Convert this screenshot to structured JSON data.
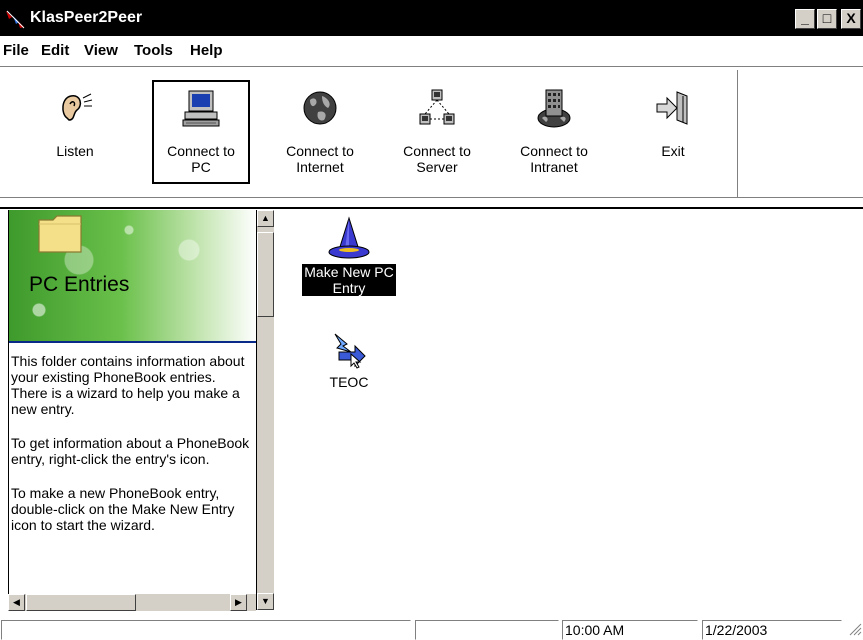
{
  "window": {
    "title": "KlasPeer2Peer",
    "min_symbol": "_",
    "max_symbol": "□",
    "close_symbol": "X"
  },
  "menu": {
    "items": [
      "File",
      "Edit",
      "View",
      "Tools",
      "Help"
    ]
  },
  "toolbar": {
    "buttons": [
      {
        "label": "Listen",
        "icon": "ear-icon",
        "pressed": false
      },
      {
        "label": "Connect to\nPC",
        "icon": "computer-icon",
        "pressed": true
      },
      {
        "label": "Connect to\nInternet",
        "icon": "globe-icon",
        "pressed": false
      },
      {
        "label": "Connect to\nServer",
        "icon": "network-icon",
        "pressed": false
      },
      {
        "label": "Connect to\nIntranet",
        "icon": "building-globe-icon",
        "pressed": false
      },
      {
        "label": "Exit",
        "icon": "exit-door-icon",
        "pressed": false
      }
    ]
  },
  "left_pane": {
    "banner_title": "PC Entries",
    "paragraphs": [
      "This folder contains information about your existing PhoneBook entries. There is a wizard to help you make a new entry.",
      "To get information about a PhoneBook entry, right-click the entry's icon.",
      "To make a new PhoneBook entry, double-click on the Make New Entry icon to start the wizard."
    ]
  },
  "items": [
    {
      "label": "Make New PC\nEntry",
      "icon": "wizard-hat-icon",
      "selected": true
    },
    {
      "label": "TEOC",
      "icon": "connection-arrow-icon",
      "selected": false
    }
  ],
  "status": {
    "panel1": "",
    "panel2": "",
    "time": "10:00 AM",
    "date": "1/22/2003"
  },
  "colors": {
    "titlebar": "#000000",
    "banner_green": "#3e9a2c",
    "selection": "#000000"
  }
}
